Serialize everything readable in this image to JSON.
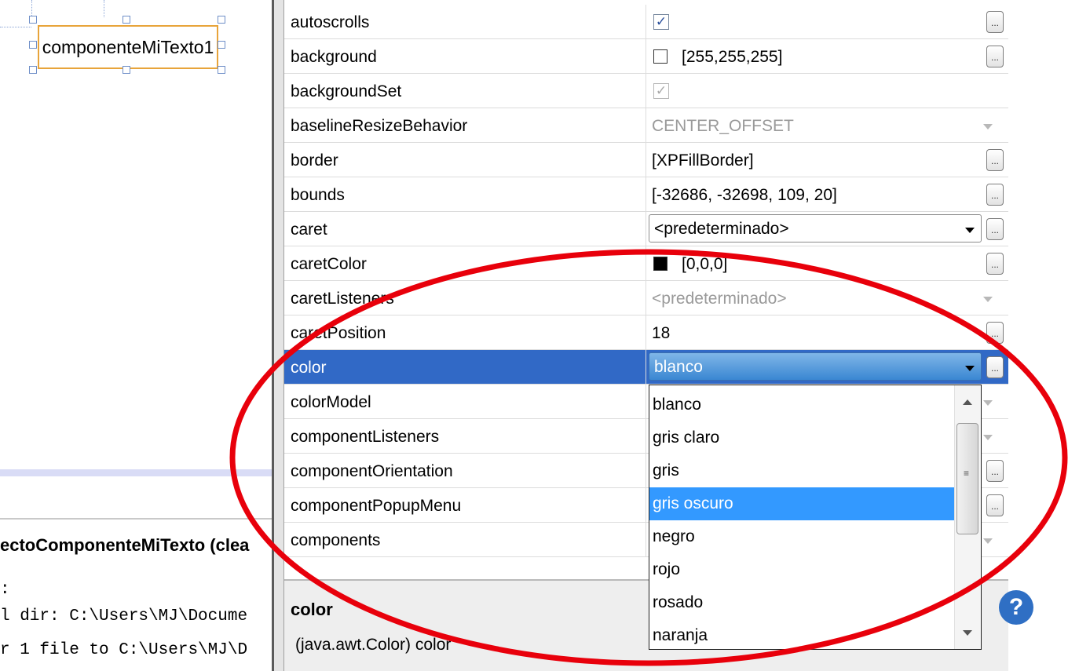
{
  "designer": {
    "component_label": "componenteMiTexto1"
  },
  "output": {
    "header": "ectoComponenteMiTexto (clea",
    "lines": [
      ":",
      "l dir: C:\\Users\\MJ\\Docume",
      "r 1 file to C:\\Users\\MJ\\D"
    ]
  },
  "properties": [
    {
      "name": "autoscrolls",
      "type": "checkbox",
      "checked": true,
      "enabled": true
    },
    {
      "name": "background",
      "type": "color",
      "swatch": "#ffffff",
      "value": "[255,255,255]"
    },
    {
      "name": "backgroundSet",
      "type": "checkbox",
      "checked": true,
      "enabled": false
    },
    {
      "name": "baselineResizeBehavior",
      "type": "combo-disabled",
      "value": "CENTER_OFFSET"
    },
    {
      "name": "border",
      "type": "text",
      "value": "[XPFillBorder]"
    },
    {
      "name": "bounds",
      "type": "text",
      "value": "[-32686, -32698, 109, 20]"
    },
    {
      "name": "caret",
      "type": "combo",
      "value": "<predeterminado>"
    },
    {
      "name": "caretColor",
      "type": "color",
      "swatch": "#000000",
      "value": "[0,0,0]"
    },
    {
      "name": "caretListeners",
      "type": "combo-disabled",
      "value": "<predeterminado>"
    },
    {
      "name": "caretPosition",
      "type": "text",
      "value": "18"
    },
    {
      "name": "color",
      "type": "combo-selected",
      "value": "blanco",
      "selected": true
    },
    {
      "name": "colorModel",
      "type": "combo-disabled",
      "value": ""
    },
    {
      "name": "componentListeners",
      "type": "combo-disabled",
      "value": ""
    },
    {
      "name": "componentOrientation",
      "type": "text",
      "value": ""
    },
    {
      "name": "componentPopupMenu",
      "type": "text",
      "value": ""
    },
    {
      "name": "components",
      "type": "combo-disabled",
      "value": ""
    }
  ],
  "dropdown": {
    "options": [
      "blanco",
      "gris claro",
      "gris",
      "gris oscuro",
      "negro",
      "rojo",
      "rosado",
      "naranja"
    ],
    "highlighted": "gris oscuro"
  },
  "description": {
    "title": "color",
    "text": "(java.awt.Color) color"
  },
  "help_icon_text": "?",
  "ellipsis_label": "...",
  "colors": {
    "selection_row": "#3169c6",
    "list_highlight": "#3399ff",
    "annotation": "#e8000b",
    "component_border": "#e8a43a"
  }
}
